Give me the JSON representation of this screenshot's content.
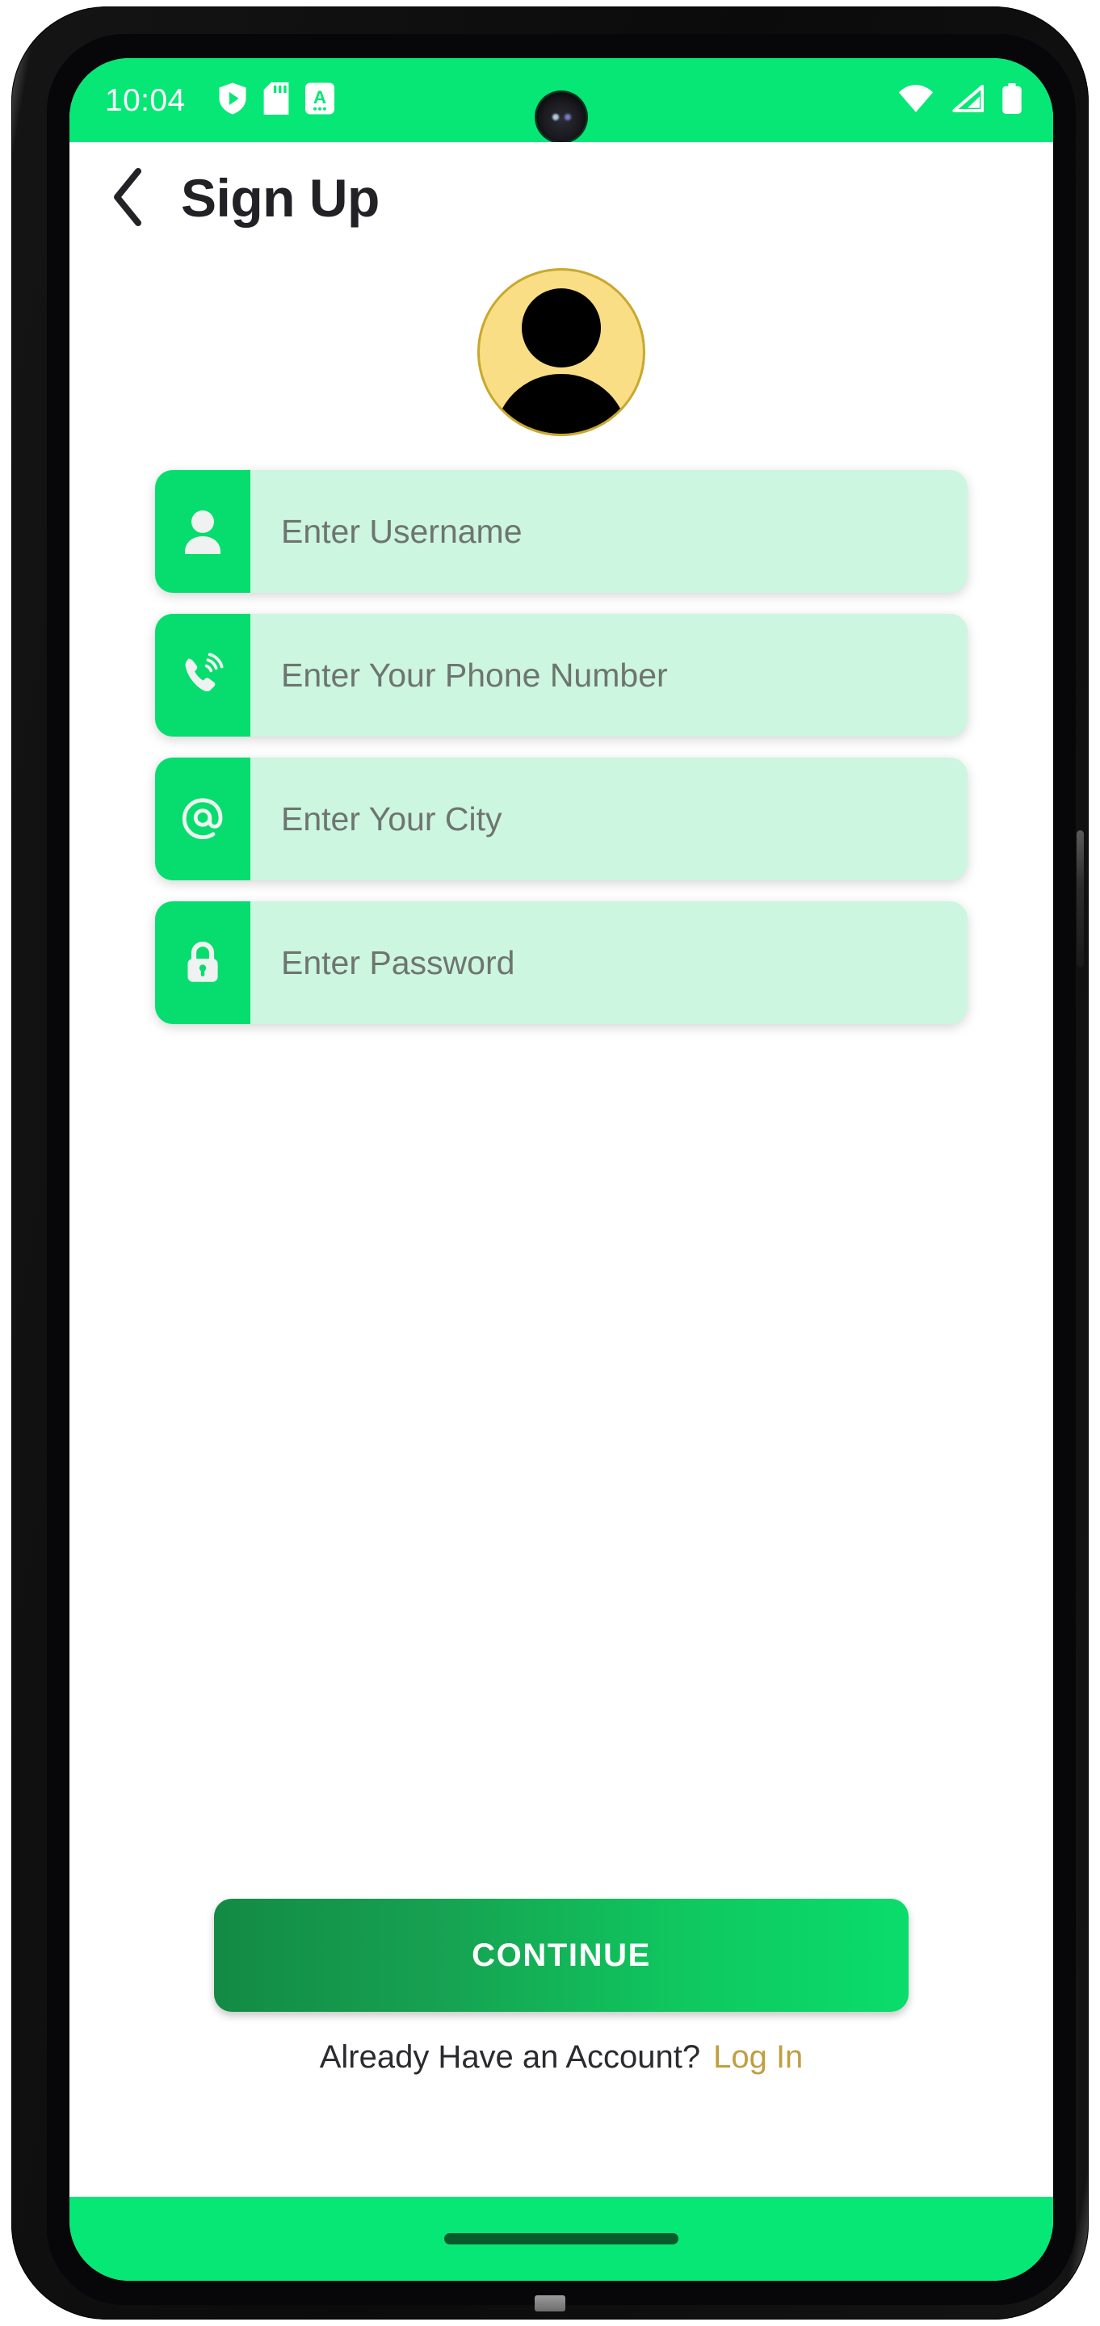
{
  "status_bar": {
    "time": "10:04",
    "left_icons": [
      "play-protect-shield-icon",
      "sd-card-icon",
      "text-detection-a-icon"
    ],
    "right_icons": [
      "wifi-icon",
      "cellular-signal-icon",
      "battery-full-icon"
    ],
    "background_color": "#06E775",
    "foreground_color": "#FFFFFF"
  },
  "appbar": {
    "back_icon": "chevron-left-icon",
    "title": "Sign Up"
  },
  "avatar": {
    "icon": "person-avatar-icon",
    "background_color": "#FADE85",
    "border_color": "#C9A82E",
    "silhouette_color": "#000000"
  },
  "form": {
    "fields": [
      {
        "name": "username",
        "icon": "person-icon",
        "placeholder": "Enter Username",
        "value": ""
      },
      {
        "name": "phone",
        "icon": "phone-ring-icon",
        "placeholder": "Enter Your Phone Number",
        "value": ""
      },
      {
        "name": "city",
        "icon": "at-sign-icon",
        "placeholder": "Enter Your City",
        "value": ""
      },
      {
        "name": "password",
        "icon": "lock-icon",
        "placeholder": "Enter Password",
        "value": ""
      }
    ],
    "icon_box_color": "#06DD6E",
    "field_background_color": "#CCF6DF",
    "placeholder_color": "#6F7470"
  },
  "cta": {
    "continue_label": "CONTINUE",
    "gradient_from": "#138A45",
    "gradient_to": "#09DD6B"
  },
  "footer": {
    "prompt": "Already Have an Account?",
    "link_label": "Log In",
    "link_color": "#BF9F41",
    "prompt_color": "#2B2B2F"
  },
  "nav_bar": {
    "gesture_pill": "home-gesture-pill",
    "background_color": "#06E775",
    "pill_color": "#0A5B2C"
  }
}
